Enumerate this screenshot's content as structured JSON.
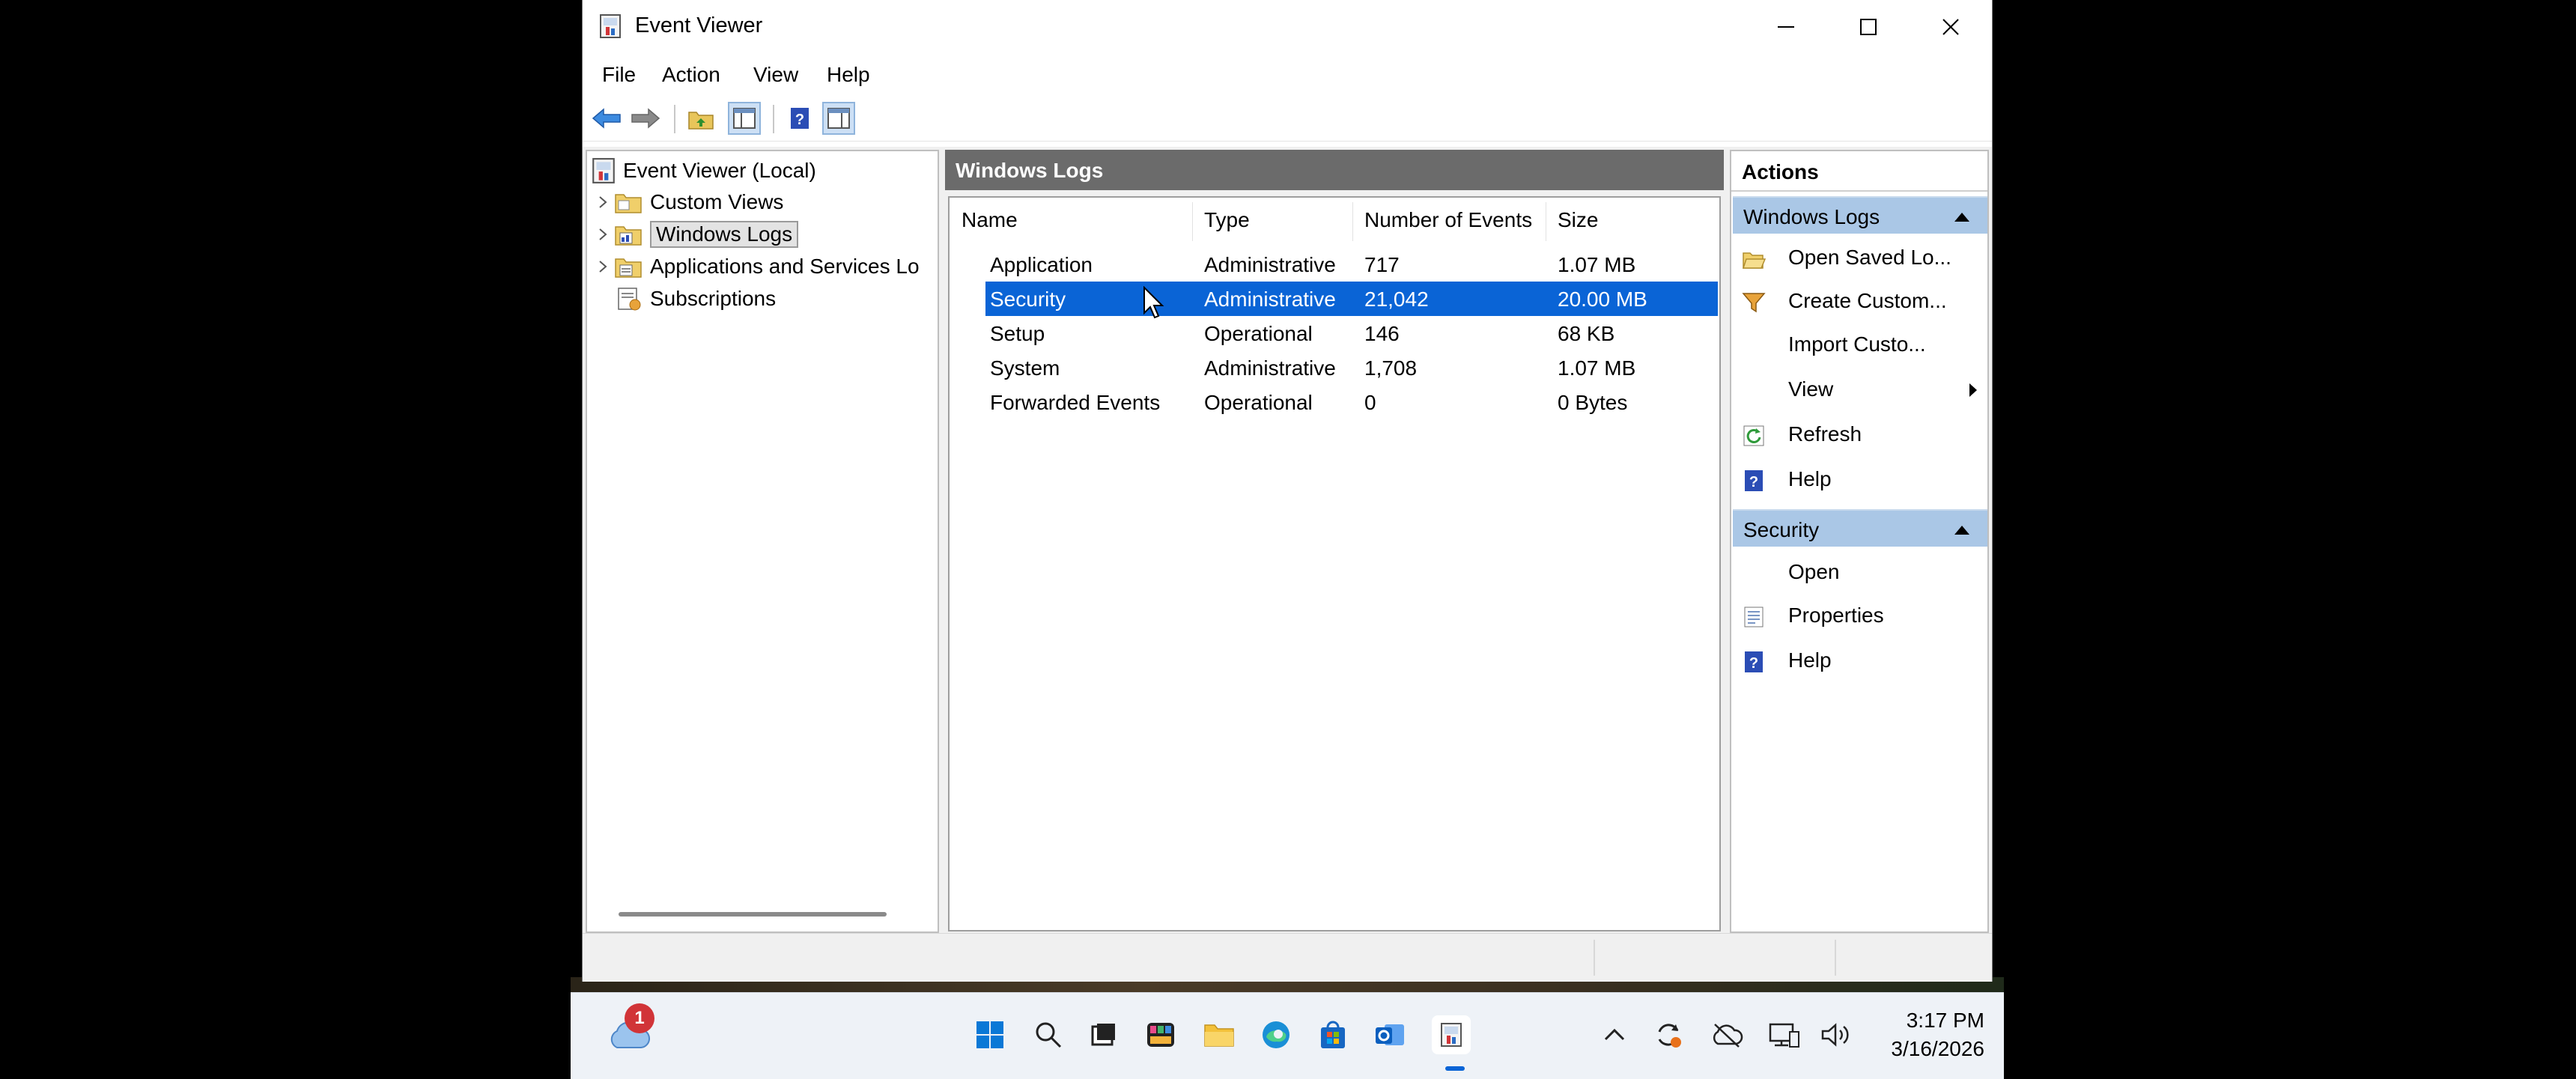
{
  "window": {
    "title": "Event Viewer"
  },
  "menu": [
    "File",
    "Action",
    "View",
    "Help"
  ],
  "tree": {
    "root": "Event Viewer (Local)",
    "items": [
      {
        "label": "Custom Views"
      },
      {
        "label": "Windows Logs"
      },
      {
        "label": "Applications and Services Lo"
      },
      {
        "label": "Subscriptions"
      }
    ]
  },
  "center": {
    "title": "Windows Logs",
    "columns": [
      "Name",
      "Type",
      "Number of Events",
      "Size"
    ],
    "rows": [
      {
        "name": "Application",
        "type": "Administrative",
        "events": "717",
        "size": "1.07 MB"
      },
      {
        "name": "Security",
        "type": "Administrative",
        "events": "21,042",
        "size": "20.00 MB"
      },
      {
        "name": "Setup",
        "type": "Operational",
        "events": "146",
        "size": "68 KB"
      },
      {
        "name": "System",
        "type": "Administrative",
        "events": "1,708",
        "size": "1.07 MB"
      },
      {
        "name": "Forwarded Events",
        "type": "Operational",
        "events": "0",
        "size": "0 Bytes"
      }
    ]
  },
  "actions": {
    "title": "Actions",
    "section1": {
      "title": "Windows Logs",
      "items": [
        "Open Saved Lo...",
        "Create Custom...",
        "Import Custo...",
        "View",
        "Refresh",
        "Help"
      ]
    },
    "section2": {
      "title": "Security",
      "items": [
        "Open",
        "Properties",
        "Help"
      ]
    }
  },
  "taskbar": {
    "badge": "1",
    "time": "3:17 PM",
    "date": "3/16/2026"
  },
  "colors": {
    "selection": "#0a64d6",
    "section_header": "#aac7e6",
    "center_header": "#6b6b6b"
  }
}
